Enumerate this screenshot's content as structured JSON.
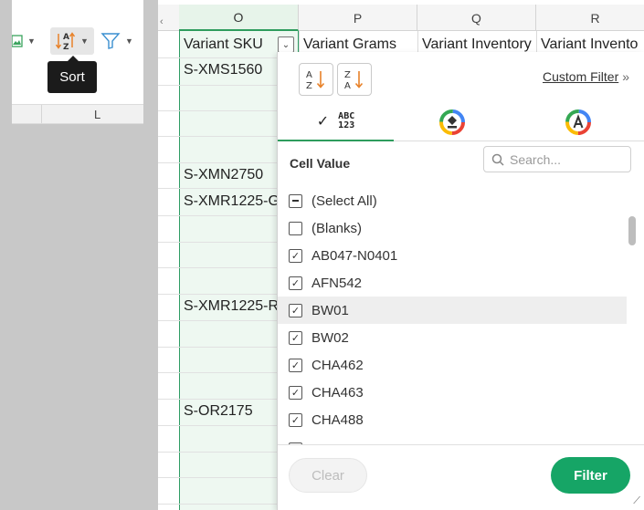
{
  "toolbar": {
    "sort_tooltip": "Sort",
    "column_L": "L",
    "icons": [
      "image-icon",
      "sort-az-icon",
      "filter-funnel-icon"
    ]
  },
  "sheet": {
    "columns": [
      "O",
      "P",
      "Q",
      "R"
    ],
    "header_cells": [
      "Variant SKU",
      "Variant Grams",
      "Variant Inventory",
      "Variant Invento"
    ],
    "skus": [
      "S-XMS1560",
      "S-XMN2750",
      "S-XMR1225-G",
      "S-XMR1225-R",
      "S-OR2175"
    ]
  },
  "popup": {
    "custom_filter_label": "Custom Filter",
    "section_label": "Cell Value",
    "tab_value_icon": "ABC 123",
    "tab_value_top": "ABC",
    "tab_value_bottom": "123",
    "search_placeholder": "Search...",
    "items": [
      {
        "label": "(Select All)",
        "state": "partial"
      },
      {
        "label": "(Blanks)",
        "state": "unchecked"
      },
      {
        "label": "AB047-N0401",
        "state": "checked"
      },
      {
        "label": "AFN542",
        "state": "checked"
      },
      {
        "label": "BW01",
        "state": "checked"
      },
      {
        "label": "BW02",
        "state": "checked"
      },
      {
        "label": "CHA462",
        "state": "checked"
      },
      {
        "label": "CHA463",
        "state": "checked"
      },
      {
        "label": "CHA488",
        "state": "checked"
      }
    ],
    "clear_label": "Clear",
    "filter_label": "Filter",
    "accent_color": "#16a566"
  }
}
